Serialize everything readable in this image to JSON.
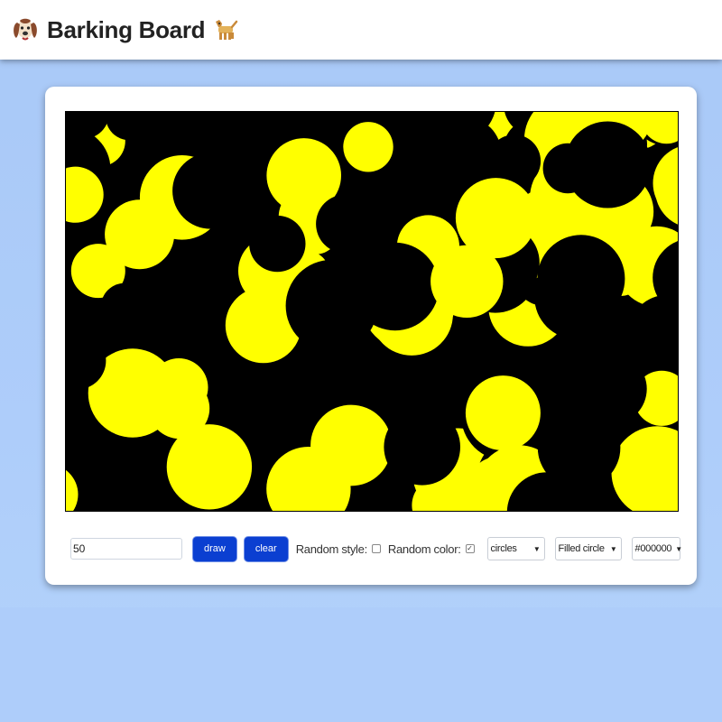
{
  "app": {
    "title": "Barking Board"
  },
  "controls": {
    "count_value": "50",
    "draw_label": "draw",
    "clear_label": "clear",
    "random_style_label": "Random style:",
    "random_style_checked": false,
    "random_color_label": "Random color:",
    "random_color_checked": true,
    "shape_select": "circles",
    "fill_select": "Filled circle",
    "color_select": "#000000"
  },
  "colors": {
    "canvas_background": "#000000",
    "shape_fill": "#ffff00",
    "button_blue": "#0b3fd1"
  }
}
